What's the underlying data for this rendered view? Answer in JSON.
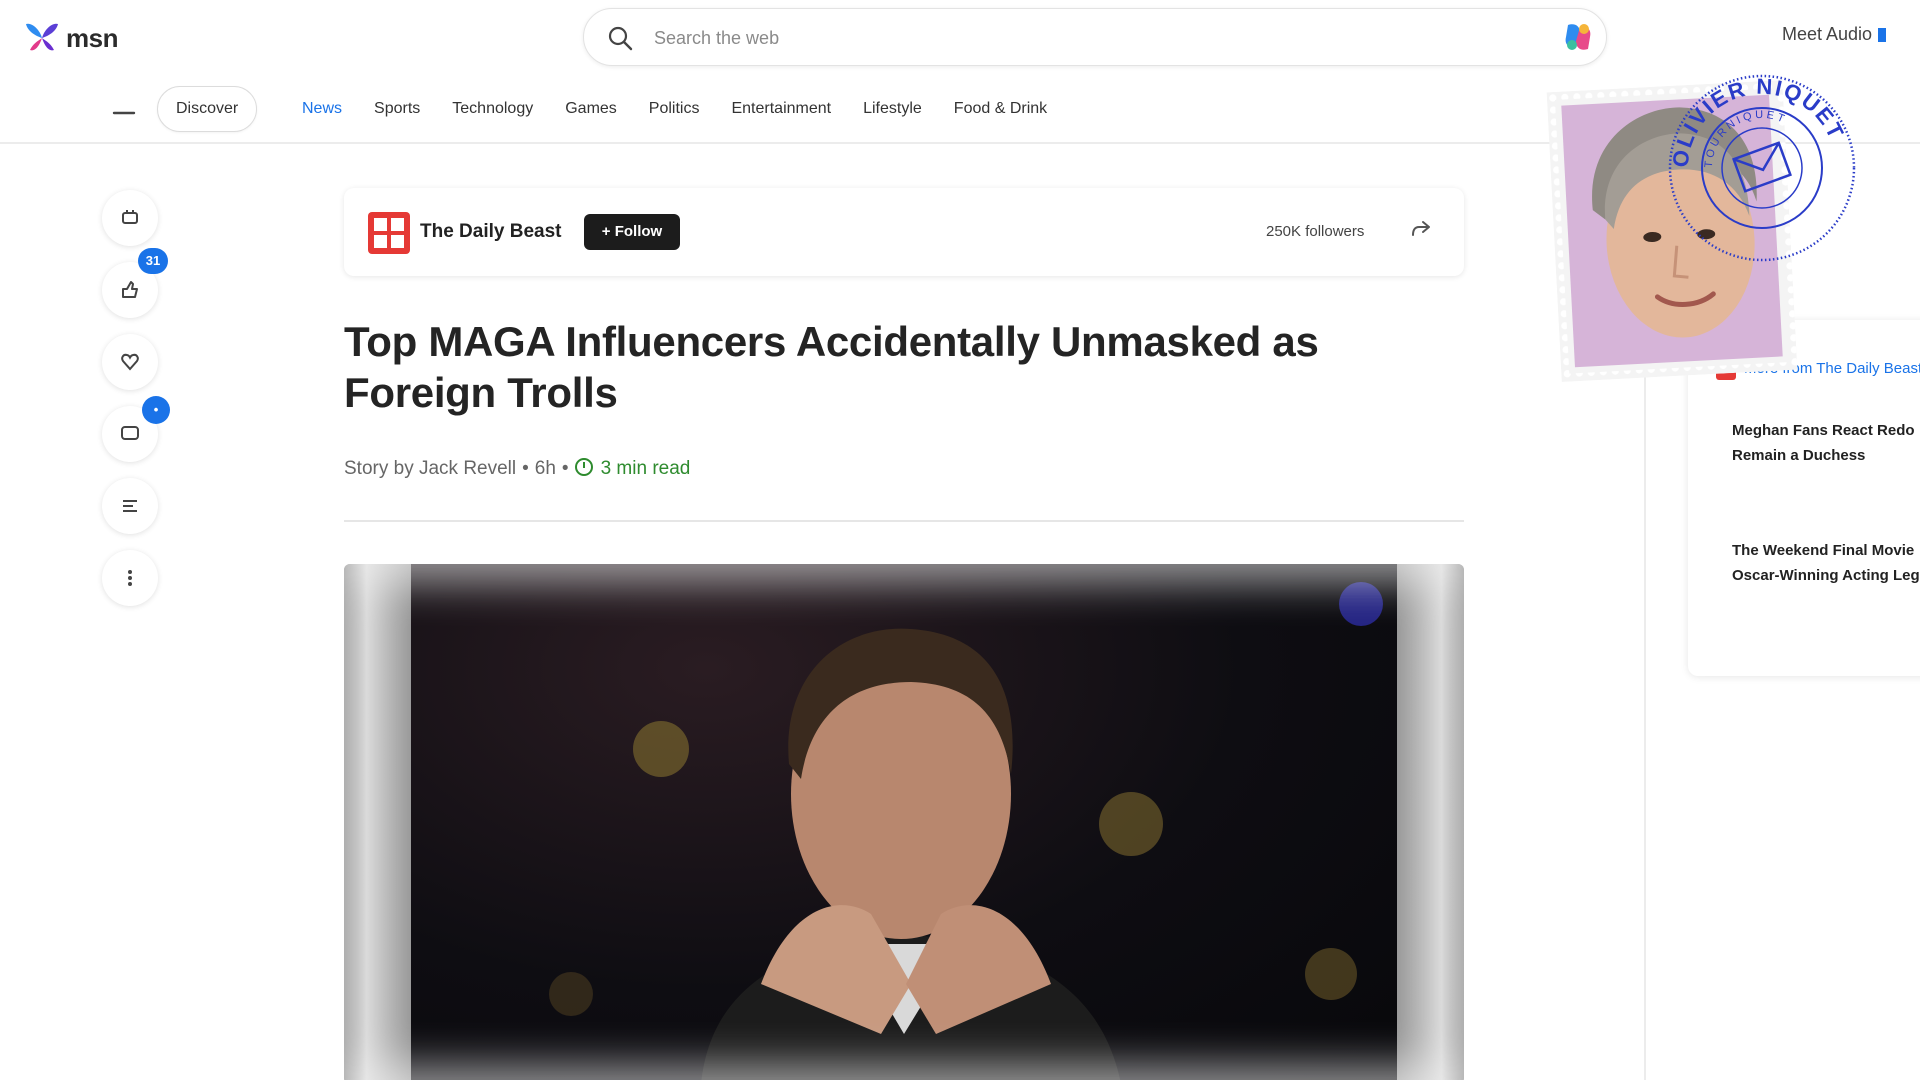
{
  "header": {
    "logo_text": "msn",
    "search_placeholder": "Search the web",
    "account_name": "Meet Audio"
  },
  "nav": {
    "pill_label": "Discover",
    "tabs": [
      "News",
      "Sports",
      "Technology",
      "Games",
      "Politics",
      "Entertainment",
      "Lifestyle",
      "Food & Drink"
    ],
    "active_tab": "News"
  },
  "rail": {
    "badge_count": "31",
    "badge_second": "•"
  },
  "article": {
    "publisher": "The Daily Beast",
    "follow_label": "+ Follow",
    "followers": "250K followers",
    "headline": "Top MAGA Influencers Accidentally Unmasked as Foreign Trolls",
    "byline_author": "Story by Jack Revell",
    "byline_age": "6h",
    "read_time": "3 min read"
  },
  "sidebar": {
    "source": "More from The Daily Beast",
    "items": [
      "Meghan Fans React Redo",
      "Remain a Duchess",
      "The Weekend Final Movie",
      "Oscar-Winning Acting Legend"
    ]
  },
  "stamp": {
    "seal_text_outer": "OLIVIER NIQUET",
    "seal_text_inner": "TOURNIQUET"
  },
  "colors": {
    "accent": "#1a73e8",
    "publisher_red": "#e53935",
    "read_time_green": "#2e8b2e",
    "seal_blue": "#2a3cc8"
  }
}
